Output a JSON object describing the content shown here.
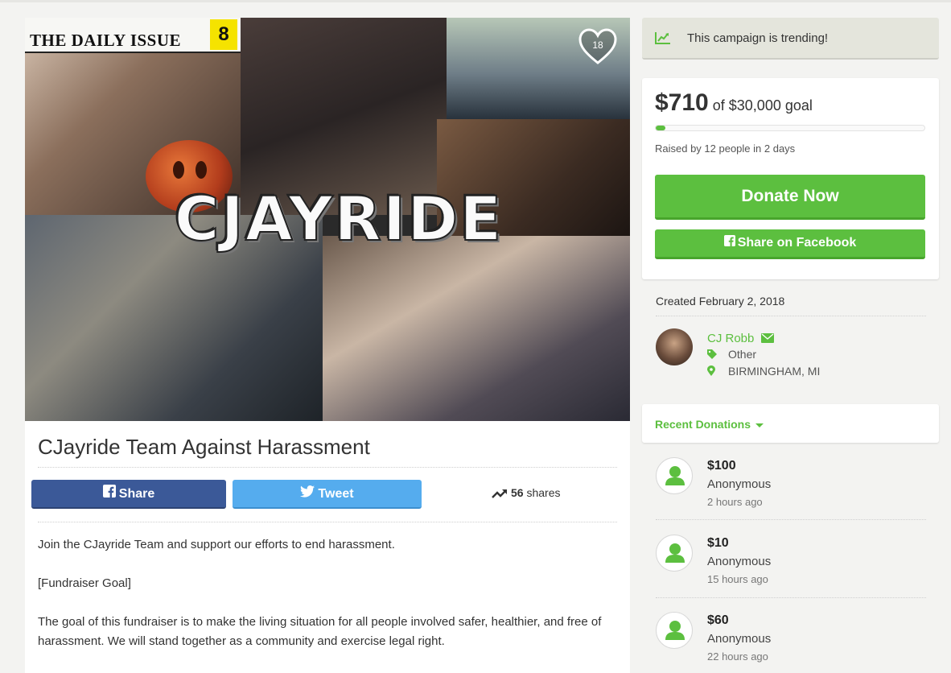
{
  "hero": {
    "newspaper_title": "THE DAILY ISSUE",
    "newspaper_number": "8",
    "logo_text": "CJAYRIDE",
    "heart_count": "18"
  },
  "campaign": {
    "title": "CJayride Team Against Harassment",
    "share_facebook_label": "Share",
    "tweet_label": "Tweet",
    "shares_count": "56",
    "shares_label": "shares",
    "description": [
      "Join the CJayride Team and support our efforts to end harassment.",
      "[Fundraiser Goal]",
      "The goal of this fundraiser is to make the living situation for all people involved safer, healthier, and free of harassment. We will stand together as a community and exercise legal right."
    ]
  },
  "sidebar": {
    "trending_text": "This campaign is trending!",
    "raised_amount": "$710",
    "goal_text": "of $30,000 goal",
    "progress_percent": 2.4,
    "raised_by": "Raised by 12 people in 2 days",
    "donate_label": "Donate Now",
    "share_facebook_label": "Share on Facebook",
    "created": "Created February 2, 2018",
    "organizer": {
      "name": "CJ Robb",
      "category": "Other",
      "location": "BIRMINGHAM, MI"
    },
    "recent_donations_label": "Recent Donations",
    "donations": [
      {
        "amount": "$100",
        "name": "Anonymous",
        "time": "2 hours ago"
      },
      {
        "amount": "$10",
        "name": "Anonymous",
        "time": "15 hours ago"
      },
      {
        "amount": "$60",
        "name": "Anonymous",
        "time": "22 hours ago"
      }
    ]
  },
  "colors": {
    "green": "#5cbf3f",
    "facebook": "#3b5998",
    "twitter": "#55acee"
  }
}
